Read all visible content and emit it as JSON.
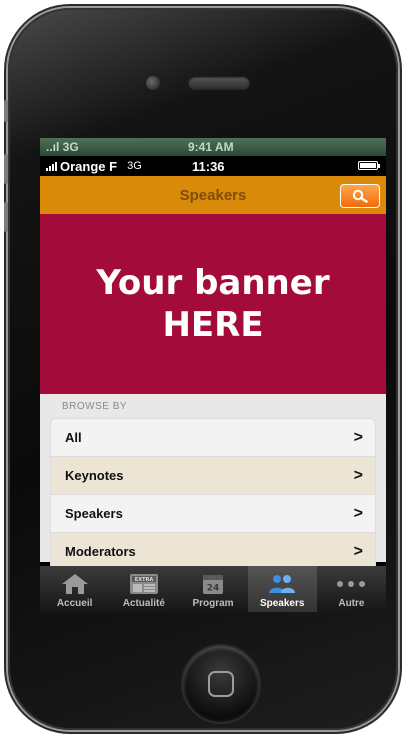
{
  "background_status": {
    "signal": "..ıl 3G",
    "time": "9:41 AM"
  },
  "status_bar": {
    "carrier": "Orange F",
    "network": "3G",
    "time": "11:36"
  },
  "nav": {
    "title": "Speakers"
  },
  "banner": {
    "line1": "Your banner",
    "line2": "HERE"
  },
  "browse": {
    "header": "BROWSE BY",
    "items": [
      {
        "label": "All"
      },
      {
        "label": "Keynotes"
      },
      {
        "label": "Speakers"
      },
      {
        "label": "Moderators"
      }
    ]
  },
  "tabs": [
    {
      "label": "Accueil",
      "icon": "home-icon"
    },
    {
      "label": "Actualité",
      "icon": "newspaper-icon",
      "badge": "EXTRA"
    },
    {
      "label": "Program",
      "icon": "calendar-icon",
      "badge": "24"
    },
    {
      "label": "Speakers",
      "icon": "people-icon",
      "active": true
    },
    {
      "label": "Autre",
      "icon": "more-icon"
    }
  ],
  "colors": {
    "nav_bar": "#d98a08",
    "banner": "#a20b3a",
    "search_button": "#f26a0c",
    "active_icon": "#3d8fe0"
  }
}
